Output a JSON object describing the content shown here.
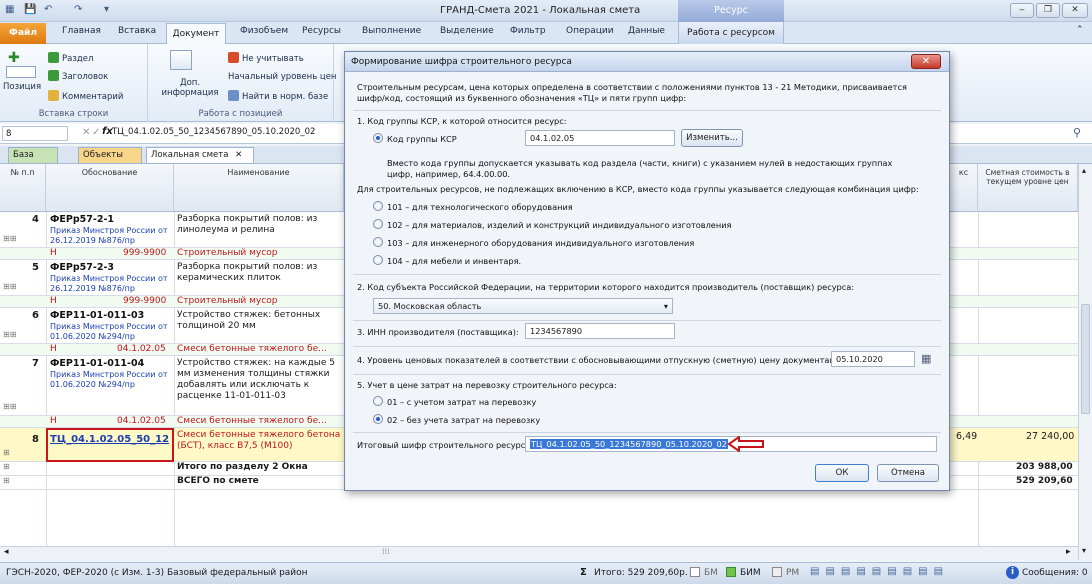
{
  "window": {
    "title": "ГРАНД-Смета 2021 - Локальная смета",
    "context_tab": "Ресурс"
  },
  "ribbon": {
    "tabs": [
      "Файл",
      "Главная",
      "Вставка",
      "Документ",
      "Физобъем",
      "Ресурсы",
      "Выполнение",
      "Выделение",
      "Фильтр",
      "Операции",
      "Данные",
      "Работа с ресурсом"
    ],
    "insert_row": {
      "position_label": "Позиция",
      "section": "Раздел",
      "heading": "Заголовок",
      "comment": "Комментарий",
      "group_label": "Вставка строки"
    },
    "position_work": {
      "extra_info": "Доп. информация",
      "ignore": "Не учитывать",
      "initial_level": "Начальный уровень цен",
      "find_norm": "Найти в норм. базе",
      "group_label": "Работа с позицией"
    }
  },
  "formula_bar": {
    "cell_ref": "8",
    "value": "ТЦ_04.1.02.05_50_1234567890_05.10.2020_02"
  },
  "doc_tabs": [
    "База",
    "Объекты",
    "Локальная смета"
  ],
  "grid": {
    "headers": {
      "num": "№ п.п",
      "basis": "Обоснование",
      "name": "Наименование",
      "cost": "Сметная стоимость в текущем уровне цен",
      "partial_ks": "кс"
    },
    "rows": [
      {
        "num": "4",
        "code": "ФЕРр57-2-1",
        "order": "Приказ Минстроя России от 26.12.2019 №876/пр",
        "name": "Разборка покрытий полов: из линолеума и релина"
      },
      {
        "h": "Н",
        "code": "999-9900",
        "name": "Строительный мусор"
      },
      {
        "num": "5",
        "code": "ФЕРр57-2-3",
        "order": "Приказ Минстроя России от 26.12.2019 №876/пр",
        "name": "Разборка покрытий полов: из керамических плиток"
      },
      {
        "h": "Н",
        "code": "999-9900",
        "name": "Строительный мусор"
      },
      {
        "num": "6",
        "code": "ФЕР11-01-011-03",
        "order": "Приказ Минстроя России от 01.06.2020 №294/пр",
        "name": "Устройство стяжек: бетонных толщиной 20 мм"
      },
      {
        "h": "Н",
        "code": "04.1.02.05",
        "name": "Смеси бетонные тяжелого бе..."
      },
      {
        "num": "7",
        "code": "ФЕР11-01-011-04",
        "order": "Приказ Минстроя России от 01.06.2020 №294/пр",
        "name": "Устройство стяжек: на каждые 5 мм изменения толщины стяжки добавлять или исключать к расценке 11-01-011-03"
      },
      {
        "h": "Н",
        "code": "04.1.02.05",
        "name": "Смеси бетонные тяжелого бе..."
      },
      {
        "num": "8",
        "code": "ТЦ_04.1.02.05_50_12",
        "name": "Смеси бетонные тяжелого бетона (БСТ), класс B7,5 (M100)",
        "partial": "6,49",
        "cost": "27 240,00"
      }
    ],
    "totals": [
      {
        "label": "Итого по разделу 2 Окна",
        "cost": "203 988,00"
      },
      {
        "label": "ВСЕГО по смете",
        "cost": "529 209,60"
      }
    ]
  },
  "dialog": {
    "title": "Формирование шифра строительного ресурса",
    "intro": "Строительным ресурсам, цена которых определена в соответствии с положениями пунктов 13 - 21 Методики, присваивается шифр/код, состоящий из буквенного обозначения «ТЦ» и пяти групп цифр:",
    "s1_label": "1. Код группы КСР, к которой относится ресурс:",
    "ksr_radio": "Код группы КСР",
    "ksr_value": "04.1.02.05",
    "change_button": "Изменить...",
    "ksr_note1": "Вместо кода группы допускается указывать код раздела (части, книги) с указанием нулей в недостающих группах",
    "ksr_note2": "цифр, например, 64.4.00.00.",
    "not_in_ksr": "Для строительных ресурсов, не подлежащих включению в КСР, вместо кода группы указывается следующая комбинация цифр:",
    "opt101": "101 – для технологического оборудования",
    "opt102": "102 – для материалов, изделий и конструкций индивидуального изготовления",
    "opt103": "103 – для инженерного оборудования индивидуального изготовления",
    "opt104": "104 – для мебели и инвентаря.",
    "s2_label": "2. Код субъекта Российской Федерации, на территории которого находится производитель (поставщик) ресурса:",
    "region": "50. Московская область",
    "s3_label": "3. ИНН производителя (поставщика):",
    "inn": "1234567890",
    "s4_label": "4. Уровень ценовых показателей в соответствии с обосновывающими отпускную (сметную) цену документами:",
    "date": "05.10.2020",
    "s5_label": "5. Учет в цене затрат на перевозку строительного ресурса:",
    "opt01": "01 – с учетом затрат на перевозку",
    "opt02": "02 – без учета затрат на перевозку",
    "result_label": "Итоговый шифр строительного ресурса:",
    "result_value": "ТЦ_04.1.02.05_50_1234567890_05.10.2020_02",
    "ok": "ОК",
    "cancel": "Отмена",
    "arrow_color": "#c8151b"
  },
  "status": {
    "left": "ГЭСН-2020, ФЕР-2020 (с Изм. 1-3)   Базовый федеральный район",
    "total": "Итого: 529 209,60р.",
    "bm": "БМ",
    "bim": "БИМ",
    "rm": "РМ",
    "messages": "Сообщения: 0"
  }
}
